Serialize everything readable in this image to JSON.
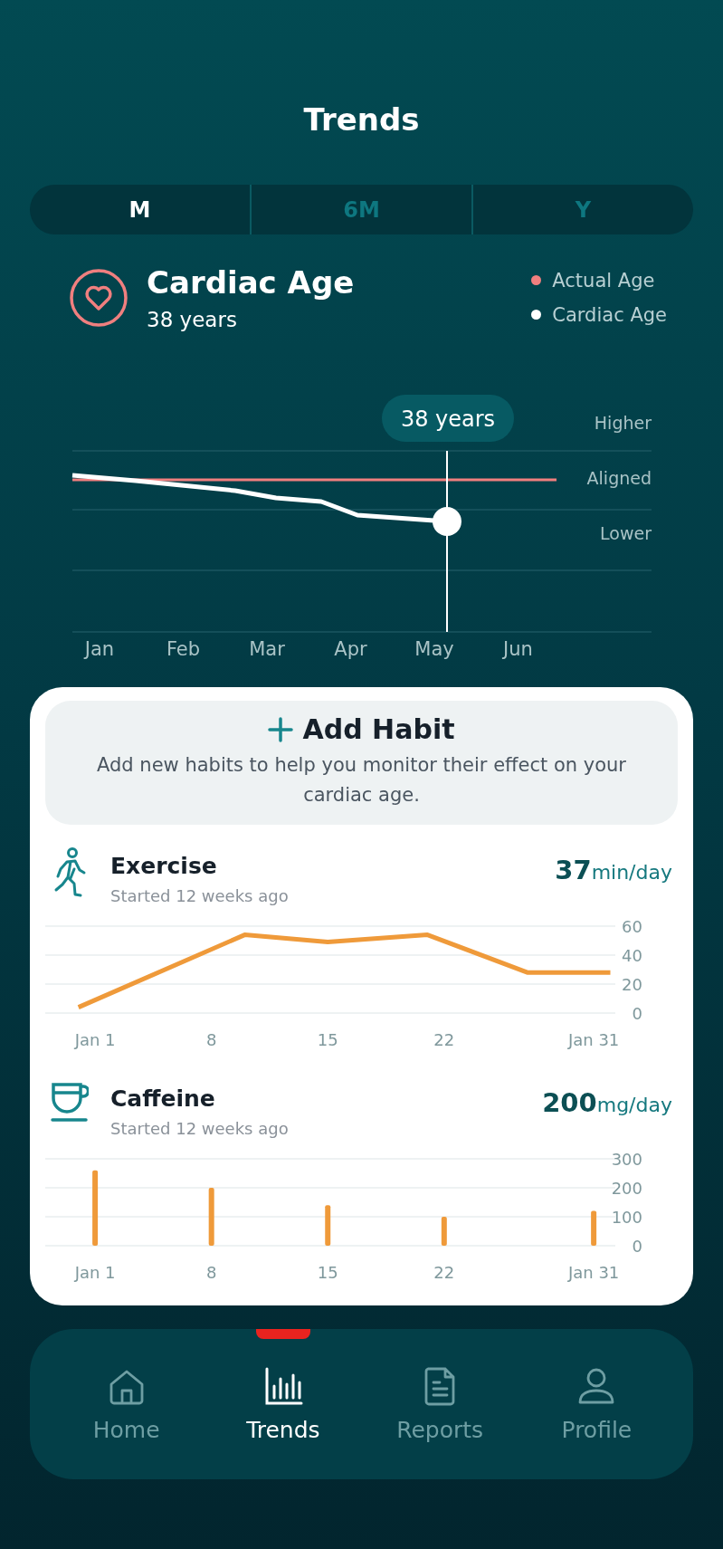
{
  "header": {
    "title": "Trends"
  },
  "periods": [
    {
      "label": "M",
      "selected": true
    },
    {
      "label": "6M",
      "selected": false
    },
    {
      "label": "Y",
      "selected": false
    }
  ],
  "metric": {
    "title": "Cardiac Age",
    "value": "38 years",
    "legend": [
      {
        "label": "Actual Age",
        "color": "#f07f7f"
      },
      {
        "label": "Cardiac Age",
        "color": "#ffffff"
      }
    ]
  },
  "trend_chart": {
    "tooltip": "38 years",
    "y_labels": [
      "Higher",
      "Aligned",
      "Lower"
    ],
    "x_labels": [
      "Jan",
      "Feb",
      "Mar",
      "Apr",
      "May",
      "Jun"
    ]
  },
  "add_habit": {
    "title": "Add Habit",
    "description": "Add new habits to help you monitor their effect on your cardiac age."
  },
  "habits": [
    {
      "kind": "exercise",
      "name": "Exercise",
      "started": "Started 12 weeks ago",
      "amount": "37",
      "unit": "min/day",
      "chart_data": {
        "type": "line",
        "x": [
          0,
          10,
          15,
          21,
          27,
          32
        ],
        "series": [
          {
            "color": "#ef9a3a",
            "values": [
              4,
              54,
              49,
              54,
              28,
              28
            ]
          }
        ],
        "xlim": [
          -2,
          32.3
        ],
        "ylim": [
          0,
          60
        ],
        "xticks": [
          {
            "value": 1,
            "label": "Jan 1"
          },
          {
            "value": 8,
            "label": "8"
          },
          {
            "value": 15,
            "label": "15"
          },
          {
            "value": 22,
            "label": "22"
          },
          {
            "value": 31,
            "label": "Jan 31"
          }
        ],
        "yticks": [
          0,
          20,
          40,
          60
        ]
      }
    },
    {
      "kind": "caffeine",
      "name": "Caffeine",
      "started": "Started 12 weeks ago",
      "amount": "200",
      "unit": "mg/day",
      "chart_data": {
        "type": "bar",
        "x": [
          1,
          8,
          15,
          22,
          31
        ],
        "series": [
          {
            "color": "#ef9a3a",
            "values": [
              260,
              200,
              140,
              100,
              120
            ]
          }
        ],
        "xlim": [
          -2,
          32.3
        ],
        "ylim": [
          0,
          300
        ],
        "xticks": [
          {
            "value": 1,
            "label": "Jan 1"
          },
          {
            "value": 8,
            "label": "8"
          },
          {
            "value": 15,
            "label": "15"
          },
          {
            "value": 22,
            "label": "22"
          },
          {
            "value": 31,
            "label": "Jan 31"
          }
        ],
        "yticks": [
          0,
          100,
          200,
          300
        ]
      }
    }
  ],
  "nav": [
    {
      "kind": "home",
      "label": "Home",
      "selected": false
    },
    {
      "kind": "trends",
      "label": "Trends",
      "selected": true
    },
    {
      "kind": "reports",
      "label": "Reports",
      "selected": false
    },
    {
      "kind": "profile",
      "label": "Profile",
      "selected": false
    }
  ]
}
